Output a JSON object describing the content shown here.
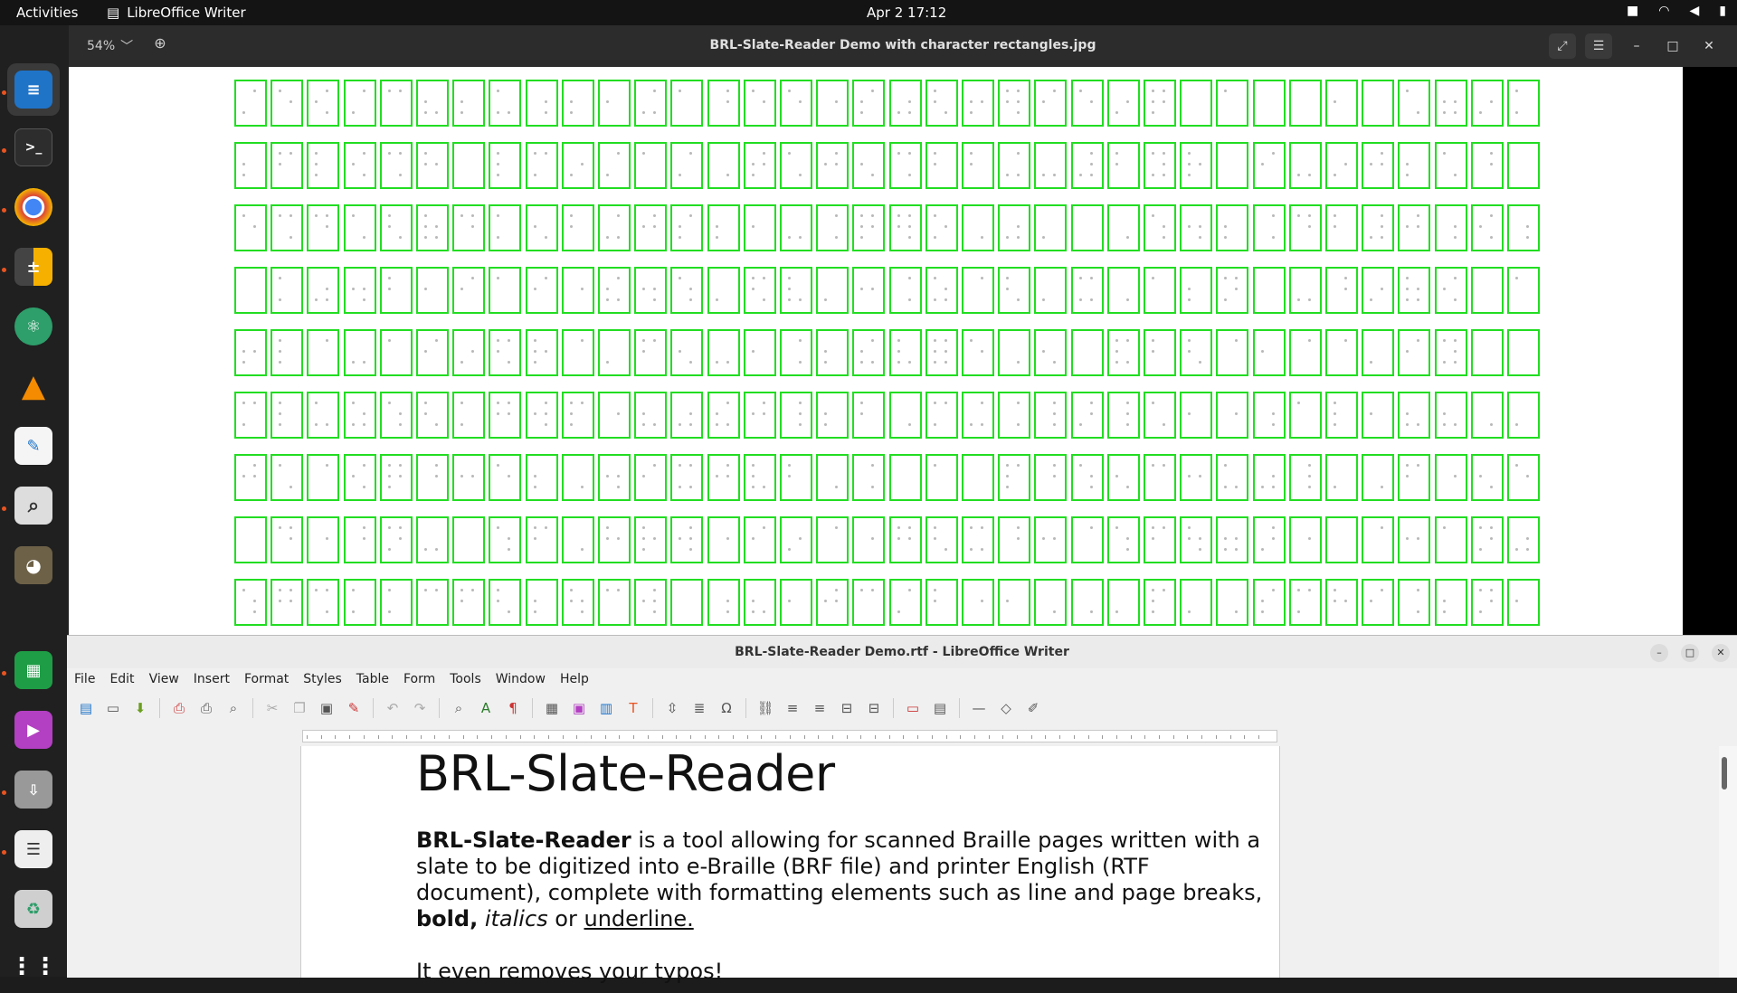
{
  "topbar": {
    "activities": "Activities",
    "app_name": "LibreOffice Writer",
    "clock": "Apr 2  17:12"
  },
  "viewer": {
    "zoom": "54%",
    "title": "BRL-Slate-Reader Demo with character rectangles.jpg",
    "grid": {
      "rows": 9,
      "cols": 36
    }
  },
  "writer": {
    "title": "BRL-Slate-Reader Demo.rtf - LibreOffice Writer",
    "menu": [
      "File",
      "Edit",
      "View",
      "Insert",
      "Format",
      "Styles",
      "Table",
      "Form",
      "Tools",
      "Window",
      "Help"
    ],
    "doc": {
      "heading": "BRL-Slate-Reader",
      "p1_bold": "BRL-Slate-Reader",
      "p1_text": " is a tool allowing for scanned Braille pages written with a slate to be digitized into e-Braille (BRF file) and printer English (RTF document), complete with formatting elements such as line and page breaks, ",
      "p1_bold2": "bold,",
      "p1_space": " ",
      "p1_italic": "italics",
      "p1_or": " or ",
      "p1_underline": "underline.",
      "p2": "It even removes your typos!"
    }
  },
  "colors": {
    "cell_border": "#22dd22",
    "accent": "#e95420"
  }
}
